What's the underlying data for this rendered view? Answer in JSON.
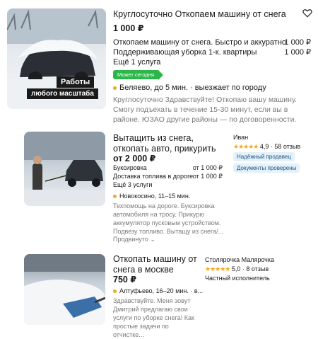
{
  "listing1": {
    "title": "Круглосуточно Откопаем машину от снега",
    "price": "1 000 ₽",
    "services": [
      {
        "name": "Откопаем машину от снега. Быстро и аккуратно",
        "price": "1 000 ₽"
      },
      {
        "name": "Поддерживающая уборка 1-к. квартиры",
        "price": "1 000 ₽"
      }
    ],
    "more": "Ещё 1 услуга",
    "badge": "Может сегодня",
    "location": "Беляево, до 5 мин. · выезжает по городу",
    "description": "Круглосуточно Здравствуйте! Откопаю вашу машину. Смогу подъехать в течение 15-30 минут, если вы в районе. ЮЗАО другие районы — по договоренности.",
    "image_caption_1": "Работы",
    "image_caption_2": "любого масштаба"
  },
  "listing2": {
    "title": "Вытащить из снега, откопать авто, прикурить",
    "price": "от 2 000 ₽",
    "services": [
      {
        "name": "Буксировка",
        "price": "от 1 000 ₽"
      },
      {
        "name": "Доставка топлива в дороге",
        "price": "от 1 000 ₽"
      }
    ],
    "more": "Ещё 3 услуги",
    "location": "Новокосино, 11–15 мин.",
    "description": "Техпомощь на дороге. Буксировка автомобиля на тросу. Прикурю аккумулятор пусковым устройством. Подвезу топливо. Вытащу из снега/...",
    "promoted": "Продвинуто",
    "seller": {
      "name": "Иван",
      "stars": "★★★★★",
      "rating": "4,9 · 58 отзыв",
      "chips": [
        "Надёжный продавец",
        "Документы проверены"
      ]
    }
  },
  "listing3": {
    "title": "Откопать машину от снега в москве",
    "price": "750 ₽",
    "location": "Алтуфьево, 16–20 мин. · в...",
    "description": "Здравствуйте. Меня зовут Дмитрий предлагаю свои услуги по уборке снега! Как простые задачи по отчистке...",
    "seller": {
      "name": "Столярочка Малярочка",
      "stars": "★★★★★",
      "rating": "5,0 · 8 отзыв",
      "type": "Частный исполнитель"
    }
  },
  "colors": {
    "accent_green": "#2bb84b",
    "location_dot": "#f5a623",
    "chip_bg": "#e3f1fb"
  }
}
